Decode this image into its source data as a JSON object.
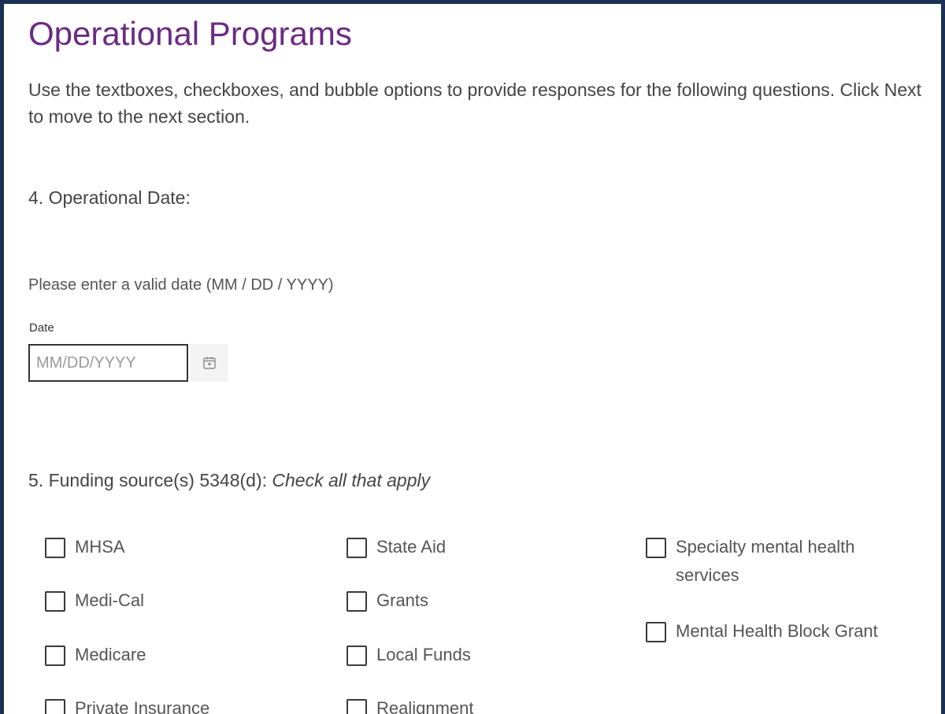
{
  "page": {
    "title": "Operational Programs",
    "instructions": "Use the textboxes, checkboxes, and bubble options to provide responses for the following questions. Click Next to move to the next section."
  },
  "question4": {
    "label": "4. Operational Date:",
    "hint": "Please enter a valid date (MM / DD / YYYY)",
    "field_label": "Date",
    "placeholder": "MM/DD/YYYY",
    "value": "",
    "icon": "calendar-icon"
  },
  "question5": {
    "label_prefix": "5. Funding source(s) 5348(d): ",
    "label_emphasis": "Check all that apply",
    "options": [
      {
        "label": "MHSA",
        "checked": false
      },
      {
        "label": "Medi-Cal",
        "checked": false
      },
      {
        "label": "Medicare",
        "checked": false
      },
      {
        "label": "Private Insurance",
        "checked": false
      },
      {
        "label": "State Aid",
        "checked": false
      },
      {
        "label": "Grants",
        "checked": false
      },
      {
        "label": "Local Funds",
        "checked": false
      },
      {
        "label": "Realignment",
        "checked": false
      },
      {
        "label": "Specialty mental health services",
        "checked": false
      },
      {
        "label": "Mental Health Block Grant",
        "checked": false
      }
    ]
  },
  "colors": {
    "title": "#6b2a83",
    "frame_border": "#1c2f55"
  }
}
